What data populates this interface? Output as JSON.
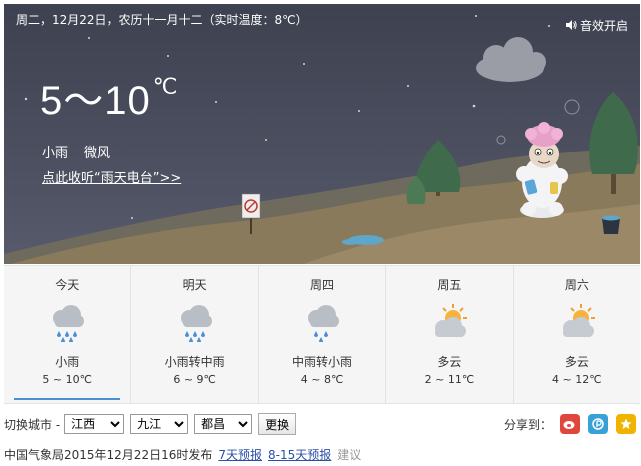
{
  "hero": {
    "topline": "周二，12月22日，农历十一月十二（实时温度：8℃）",
    "sound_label": "音效开启",
    "temp_range": "5～10",
    "temp_unit": "℃",
    "condition": "小雨",
    "wind": "微风",
    "radio_link": "点此收听“雨天电台”>>",
    "sky_color": "#434656",
    "hill_color": "#8b7a5a"
  },
  "forecast": [
    {
      "name": "今天",
      "icon": "rain-cloud-icon",
      "desc": "小雨",
      "range": "5 ~ 10℃",
      "selected": true
    },
    {
      "name": "明天",
      "icon": "rain-cloud-icon",
      "desc": "小雨转中雨",
      "range": "6 ~ 9℃",
      "selected": false
    },
    {
      "name": "周四",
      "icon": "rain-cloud-icon",
      "desc": "中雨转小雨",
      "range": "4 ~ 8℃",
      "selected": false
    },
    {
      "name": "周五",
      "icon": "partly-cloudy-icon",
      "desc": "多云",
      "range": "2 ~ 11℃",
      "selected": false
    },
    {
      "name": "周六",
      "icon": "partly-cloudy-icon",
      "desc": "多云",
      "range": "4 ~ 12℃",
      "selected": false
    }
  ],
  "city_switch": {
    "label": "切换城市 -",
    "province": "江西",
    "city": "九江",
    "district": "都昌",
    "button": "更换"
  },
  "share": {
    "label": "分享到：",
    "icons": [
      "weibo-icon",
      "pengyou-icon",
      "star-icon"
    ],
    "colors": [
      "#e0463c",
      "#3aa0d8",
      "#f0b400"
    ]
  },
  "footer": {
    "publish": "中国气象局2015年12月22日16时发布",
    "link7": "7天预报",
    "link15": "8-15天预报",
    "suggest": "建议"
  }
}
